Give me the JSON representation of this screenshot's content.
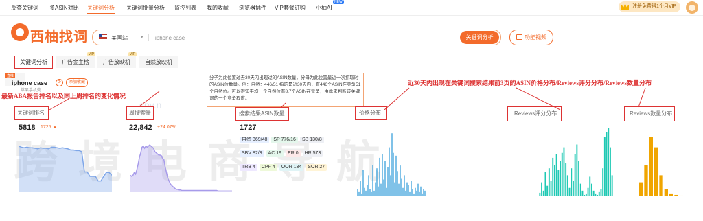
{
  "nav": {
    "items": [
      "反查关键词",
      "多ASIN对比",
      "关键词分析",
      "关键词批量分析",
      "监控列表",
      "我的收藏",
      "浏览器插件",
      "VIP套餐订购",
      "小柚AI"
    ],
    "active_index": 2,
    "ai_badge": "NEW",
    "vip_promo": "注册免费得1个月VIP"
  },
  "brand": {
    "logo_text": "西柚找词",
    "accent": "#f36b2b"
  },
  "search": {
    "marketplace": "美国站",
    "query": "iphone case",
    "button": "关键词分析",
    "video_button": "功能视频"
  },
  "tabs": [
    {
      "label": "关键词分析",
      "vip": false,
      "active": true
    },
    {
      "label": "广告金主榜",
      "vip": true,
      "active": false
    },
    {
      "label": "广告放映机",
      "vip": true,
      "active": false
    },
    {
      "label": "自然放映机",
      "vip": false,
      "active": false
    }
  ],
  "vip_label": "VIP",
  "keyword": {
    "name": "iphone case",
    "tag": "直推",
    "sub": "苹果手机壳",
    "add_button": "添加收藏"
  },
  "annotations": {
    "rank_note": "最新ABA报告排名以及同上周排名的变化情况",
    "price_note": "近30天内出现在关键词搜索结果前3页的ASIN价格分布/Reviews评分分布/Reviews数量分布",
    "tooltip": "分子为此位置过去30天内出现过的ASIN数量，分母为此位置最近一次抓取时的ASIN位数量。例：自然：446/51 指的是近30天内，有446个ASIN在竞争51个自然位。可以得知平均一个自然位有8.7个ASIN在竞争，由此来判断该关键词的一个竞争程度。"
  },
  "metrics": {
    "rank": {
      "label": "关键词排名",
      "value": "5818",
      "delta": "1725"
    },
    "searches": {
      "label": "周搜索量",
      "value": "22,842",
      "delta": "+24.07%"
    },
    "asin": {
      "label": "搜索结果ASIN数量",
      "value": "1727"
    },
    "price_dist": {
      "label": "价格分布"
    },
    "rating_dist": {
      "label": "Reviews评分分布"
    },
    "review_dist": {
      "label": "Reviews数量分布"
    }
  },
  "chips": [
    {
      "text": "自然 369/48",
      "cls": "c-blue"
    },
    {
      "text": "SP 776/16",
      "cls": "c-green"
    },
    {
      "text": "SB 130/8",
      "cls": "c-grey"
    },
    {
      "text": "SBV 82/3",
      "cls": "c-blue"
    },
    {
      "text": "AC 19",
      "cls": "c-green"
    },
    {
      "text": "ER 0",
      "cls": "c-red"
    },
    {
      "text": "HR 573",
      "cls": "c-grey"
    },
    {
      "text": "TRB 4",
      "cls": "c-purple"
    },
    {
      "text": "CPF 4",
      "cls": "c-lime"
    },
    {
      "text": "OOR 134",
      "cls": "c-teal"
    },
    {
      "text": "SOR 27",
      "cls": "c-gold"
    }
  ],
  "watermark": {
    "big": "跨境电商导航",
    "small": "spy.n"
  },
  "chart_data": [
    {
      "type": "area",
      "series": [
        {
          "values": [
            82,
            80,
            79,
            80,
            79,
            79,
            78,
            77,
            79,
            78,
            78,
            77,
            80,
            80,
            79,
            78,
            79,
            78,
            77,
            75,
            75,
            74,
            74,
            72,
            36,
            36,
            28,
            28,
            28,
            20,
            20,
            28,
            35,
            35,
            30
          ]
        }
      ],
      "color": "#7ea6e8"
    },
    {
      "type": "area",
      "series": [
        {
          "values": [
            30,
            28,
            30,
            35,
            32,
            40,
            50,
            62,
            70,
            80,
            82,
            78,
            82,
            80,
            82,
            84,
            82,
            80,
            78,
            72,
            70,
            68,
            66,
            66,
            65,
            60,
            58,
            45,
            35,
            25,
            20,
            15,
            12,
            10,
            8,
            6,
            5,
            5,
            4,
            4,
            3,
            3,
            3,
            3,
            3,
            3,
            3,
            3,
            3,
            3,
            3,
            3,
            3,
            3,
            3,
            3,
            3,
            3,
            3,
            3,
            3,
            3,
            3,
            3,
            3,
            3,
            3,
            3,
            2,
            2,
            2,
            2,
            2,
            2,
            2,
            2,
            2,
            2,
            2,
            2
          ]
        }
      ],
      "color": "#a79bea"
    },
    {
      "type": "bar",
      "color": "#2b9ad9",
      "values": [
        10,
        6,
        22,
        4,
        38,
        12,
        8,
        16,
        30,
        10,
        6,
        45,
        8,
        20,
        40,
        14,
        55,
        18,
        60,
        24,
        50,
        12,
        42,
        70,
        30,
        90,
        62,
        20,
        58,
        36,
        18,
        44,
        25,
        12,
        30,
        8,
        20,
        16,
        6,
        22,
        10,
        4,
        12,
        8,
        18,
        6,
        14,
        4,
        10,
        8
      ]
    },
    {
      "type": "bar",
      "color": "#1fc9b4",
      "values": [
        5,
        20,
        8,
        35,
        15,
        40,
        22,
        55,
        45,
        60,
        38,
        50,
        62,
        70,
        48,
        30,
        12,
        40,
        22,
        60,
        74,
        50,
        18,
        8,
        2,
        4,
        12,
        28,
        18,
        8,
        4,
        2,
        6,
        10,
        40,
        85,
        92,
        98,
        70,
        30
      ]
    },
    {
      "type": "bar",
      "color": "#f0a500",
      "values": [
        20,
        45,
        85,
        70,
        30,
        10,
        4,
        2,
        1
      ]
    }
  ]
}
